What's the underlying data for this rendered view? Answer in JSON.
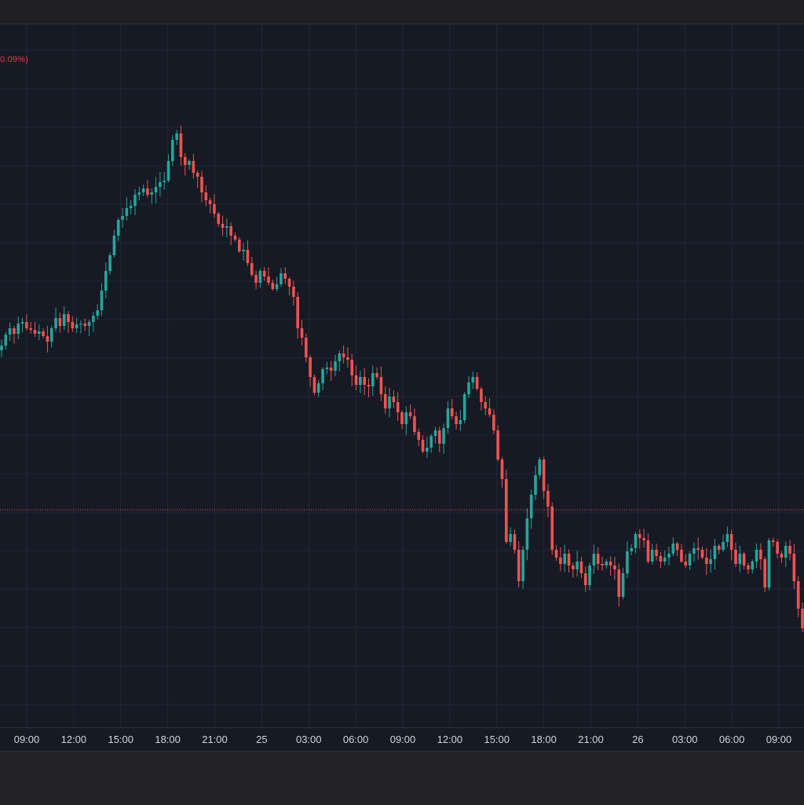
{
  "colors": {
    "background": "#161a25",
    "grid": "#232733",
    "up": "#26a69a",
    "down": "#ef5350",
    "axis_text": "#d1d4dc",
    "last_price_line": "#ef5350"
  },
  "legend": {
    "change_text": "0.09%)"
  },
  "chart_data": {
    "type": "candlestick",
    "grid": true,
    "price_line": "dotted horizontal line at last price level",
    "x_ticks": [
      "09:00",
      "12:00",
      "15:00",
      "18:00",
      "21:00",
      "25",
      "03:00",
      "06:00",
      "09:00",
      "12:00",
      "15:00",
      "18:00",
      "21:00",
      "26",
      "03:00",
      "06:00",
      "09:00"
    ],
    "closes": [
      440,
      426,
      418,
      425,
      412,
      410,
      418,
      420,
      425,
      422,
      428,
      435,
      418,
      405,
      415,
      400,
      410,
      418,
      413,
      412,
      415,
      410,
      402,
      395,
      370,
      345,
      325,
      300,
      280,
      275,
      265,
      262,
      248,
      245,
      240,
      248,
      245,
      238,
      232,
      230,
      205,
      178,
      170,
      200,
      210,
      205,
      220,
      225,
      245,
      255,
      260,
      272,
      285,
      290,
      288,
      300,
      305,
      320,
      318,
      335,
      350,
      360,
      345,
      352,
      360,
      368,
      362,
      348,
      355,
      365,
      378,
      418,
      430,
      455,
      480,
      500,
      488,
      470,
      468,
      472,
      460,
      450,
      455,
      458,
      478,
      490,
      480,
      490,
      492,
      475,
      480,
      502,
      520,
      505,
      512,
      525,
      540,
      525,
      530,
      550,
      560,
      575,
      570,
      555,
      548,
      565,
      545,
      520,
      530,
      540,
      535,
      502,
      487,
      480,
      495,
      512,
      520,
      528,
      548,
      585,
      610,
      690,
      680,
      700,
      740,
      700,
      660,
      630,
      605,
      585,
      625,
      645,
      700,
      710,
      718,
      705,
      720,
      725,
      715,
      730,
      745,
      720,
      705,
      718,
      720,
      715,
      720,
      725,
      760,
      730,
      702,
      698,
      680,
      685,
      688,
      715,
      700,
      708,
      715,
      710,
      705,
      692,
      700,
      715,
      720,
      705,
      698,
      700,
      710,
      718,
      712,
      695,
      700,
      690,
      680,
      700,
      718,
      705,
      720,
      725,
      715,
      700,
      712,
      748,
      688,
      690,
      705,
      710,
      695,
      705,
      740,
      775,
      800
    ]
  }
}
